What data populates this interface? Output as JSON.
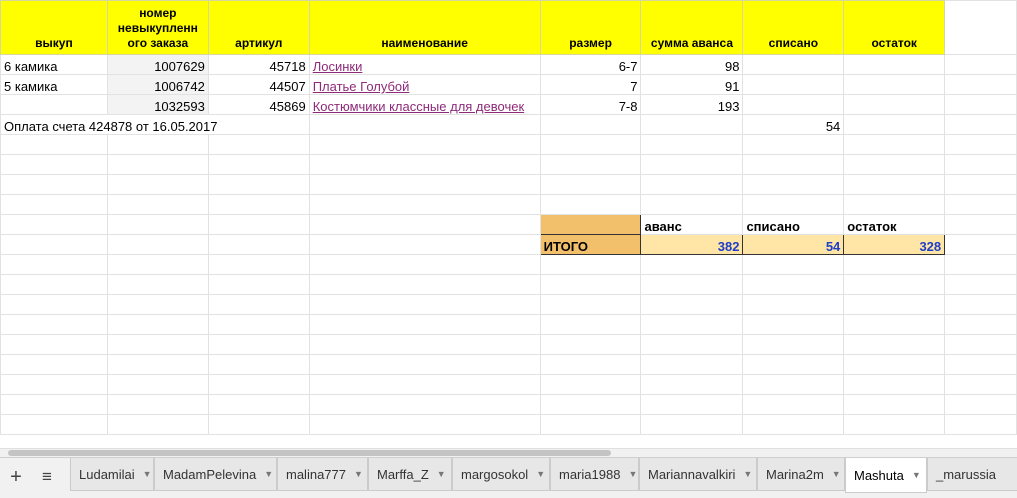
{
  "headers": [
    "выкуп",
    "номер невыкупленн ого заказа",
    "артикул",
    "наименование",
    "размер",
    "сумма аванса",
    "списано",
    "остаток"
  ],
  "rows": [
    {
      "vykup": "6 камика",
      "order": "1007629",
      "art": "45718",
      "name": "Лосинки",
      "size": "6-7",
      "avans": "98"
    },
    {
      "vykup": "5 камика",
      "order": "1006742",
      "art": "44507",
      "name": "Платье Голубой",
      "size": "7",
      "avans": "91"
    },
    {
      "vykup": "",
      "order": "1032593",
      "art": "45869",
      "name": "Костюмчики классные для девочек",
      "size": "7-8",
      "avans": "193"
    }
  ],
  "payment": {
    "text": "Оплата счета 424878 от 16.05.2017",
    "spisano": "54"
  },
  "summary": {
    "label": "ИТОГО",
    "headers": [
      "аванс",
      "списано",
      "остаток"
    ],
    "values": [
      "382",
      "54",
      "328"
    ]
  },
  "toolbar": {
    "add_icon": "+",
    "list_icon": "≡"
  },
  "tabs": [
    "Ludamilai",
    "MadamPelevina",
    "malina777",
    "Marffa_Z",
    "margosokol",
    "maria1988",
    "Mariannavalkiri",
    "Marina2m",
    "Mashuta",
    "_marussia"
  ],
  "active_tab": "Mashuta",
  "colors": {
    "header_yellow": "#ffff00",
    "summary_orange": "#f2c06a",
    "total_fill": "#ffe5a6",
    "link": "#8e2a7a",
    "total_text": "#1e3ec8"
  }
}
